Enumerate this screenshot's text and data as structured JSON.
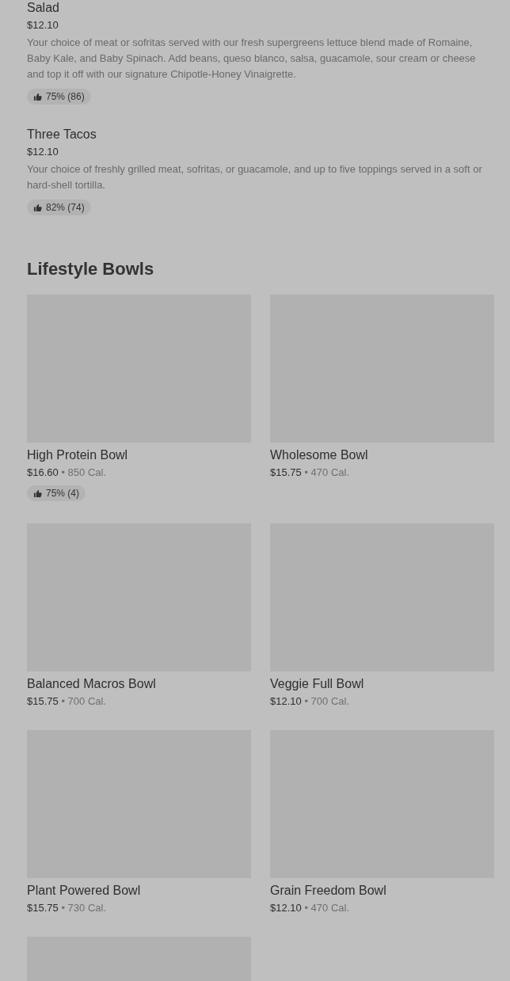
{
  "items": [
    {
      "name": "Salad",
      "price": "$12.10",
      "description": "Your choice of meat or sofritas served with our fresh supergreens lettuce blend made of Romaine, Baby Kale, and Baby Spinach. Add beans, queso blanco, salsa, guacamole, sour cream or cheese and top it off with our signature Chipotle-Honey Vinaigrette.",
      "rating": "75% (86)"
    },
    {
      "name": "Three Tacos",
      "price": "$12.10",
      "description": "Your choice of freshly grilled meat, sofritas, or guacamole, and up to five toppings served in a soft or hard-shell tortilla.",
      "rating": "82% (74)"
    }
  ],
  "section": {
    "title": "Lifestyle Bowls",
    "cards": [
      {
        "kind": "product",
        "name": "High Protein Bowl",
        "price": "$16.60",
        "separator": "•",
        "calories": "850 Cal.",
        "rating": "75% (4)"
      },
      {
        "kind": "product",
        "name": "Wholesome Bowl",
        "price": "$15.75",
        "separator": "•",
        "calories": "470 Cal."
      },
      {
        "kind": "product",
        "name": "Balanced Macros Bowl",
        "price": "$15.75",
        "separator": "•",
        "calories": "700 Cal."
      },
      {
        "kind": "product",
        "name": "Veggie Full Bowl",
        "price": "$12.10",
        "separator": "•",
        "calories": "700 Cal."
      },
      {
        "kind": "product",
        "name": "Plant Powered Bowl",
        "price": "$15.75",
        "separator": "•",
        "calories": "730 Cal."
      },
      {
        "kind": "product",
        "name": "Grain Freedom Bowl",
        "price": "$12.10",
        "separator": "•",
        "calories": "470 Cal."
      },
      {
        "kind": "image-only"
      }
    ]
  }
}
